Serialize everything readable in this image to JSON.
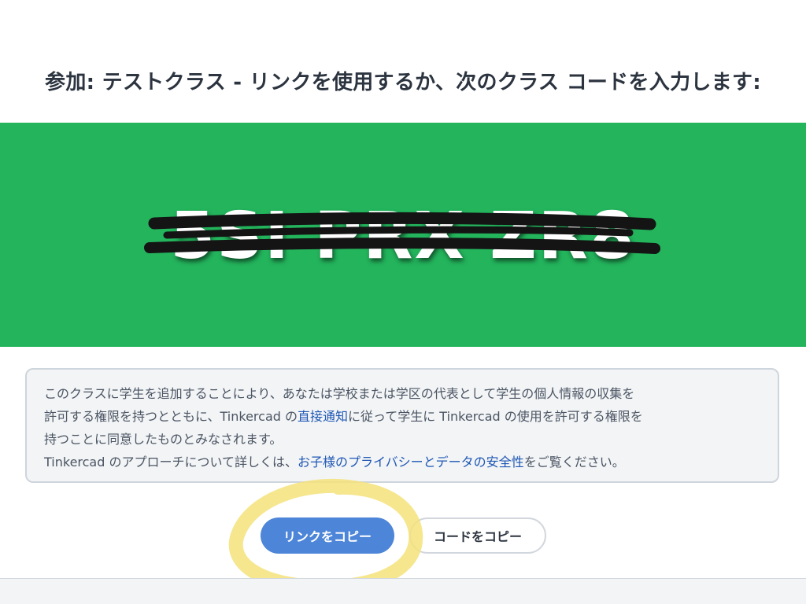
{
  "heading": "参加: テストクラス - リンクを使用するか、次のクラス コードを入力します:",
  "class_code": "5SI PRX ZR8",
  "colors": {
    "banner": "#23b45c",
    "primary_button": "#4d85d8",
    "link": "#1f57b4",
    "annotation": "#f5e27a"
  },
  "notice": {
    "line1": "このクラスに学生を追加することにより、あなたは学校または学区の代表として学生の個人情報の収集を",
    "line2_before": "許可する権限を持つとともに、Tinkercad の",
    "line2_link": "直接通知",
    "line2_after": "に従って学生に Tinkercad の使用を許可する権限を",
    "line3": "持つことに同意したものとみなされます。",
    "line4_before": "Tinkercad のアプローチについて詳しくは、",
    "line4_link": "お子様のプライバシーとデータの安全性",
    "line4_after": "をご覧ください。"
  },
  "buttons": {
    "copy_link": "リンクをコピー",
    "copy_code": "コードをコピー"
  }
}
